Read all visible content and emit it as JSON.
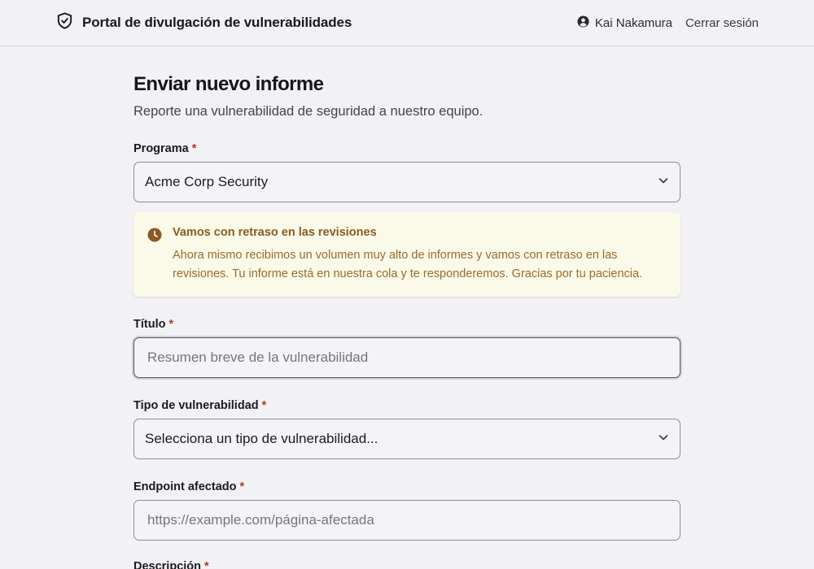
{
  "header": {
    "title": "Portal de divulgación de vulnerabilidades",
    "user_name": "Kai Nakamura",
    "logout_label": "Cerrar sesión"
  },
  "page": {
    "title": "Enviar nuevo informe",
    "subtitle": "Reporte una vulnerabilidad de seguridad a nuestro equipo."
  },
  "form": {
    "program": {
      "label": "Programa",
      "required_mark": "*",
      "selected": "Acme Corp Security"
    },
    "notice": {
      "title": "Vamos con retraso en las revisiones",
      "body": "Ahora mismo recibimos un volumen muy alto de informes y vamos con retraso en las revisiones. Tu informe está en nuestra cola y te responderemos. Gracias por tu paciencia."
    },
    "title_field": {
      "label": "Título",
      "required_mark": "*",
      "placeholder": "Resumen breve de la vulnerabilidad"
    },
    "vuln_type": {
      "label": "Tipo de vulnerabilidad",
      "required_mark": "*",
      "selected": "Selecciona un tipo de vulnerabilidad..."
    },
    "endpoint": {
      "label": "Endpoint afectado",
      "required_mark": "*",
      "placeholder": "https://example.com/página-afectada"
    },
    "description": {
      "label": "Descripción",
      "required_mark": "*"
    }
  },
  "colors": {
    "accent_required": "#b4352b",
    "notice_bg": "#fbfae8",
    "notice_text": "#9a6a2e",
    "background": "#f2f1f5"
  },
  "icons": {
    "brand": "shield-check-icon",
    "user": "user-circle-icon",
    "notice": "clock-icon",
    "select": "chevron-down-icon"
  }
}
